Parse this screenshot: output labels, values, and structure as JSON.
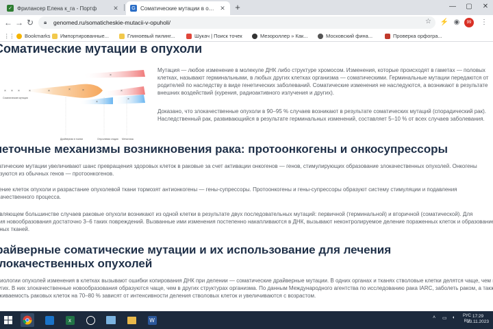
{
  "browser": {
    "tabs": [
      {
        "title": "Фрилансер Елена к_га - Портф",
        "active": false,
        "favicon_color": "#2e7d32"
      },
      {
        "title": "Соматические мутации в опухо",
        "active": true,
        "favicon_color": "#2a6dc6"
      }
    ],
    "new_tab_label": "+",
    "url": "genomed.ru/somaticheskie-mutacii-v-opuholi/",
    "bookmarks": [
      {
        "label": "Bookmarks",
        "color": "#f5b400"
      },
      {
        "label": "Импортированные...",
        "color": "#f2c94c"
      },
      {
        "label": "Глиноевый пилинг...",
        "color": "#f2c94c"
      },
      {
        "label": "Шукач | Поиск точек",
        "color": "#e0463a"
      },
      {
        "label": "Мезороллер » Как...",
        "color": "#333333"
      },
      {
        "label": "Московский фина...",
        "color": "#555555"
      },
      {
        "label": "Проверка орфогра...",
        "color": "#c0392b"
      }
    ],
    "badge_count": "99"
  },
  "article": {
    "title": "Соматические мутации в опухоли",
    "figure_labels": {
      "origin": "Соматические мутации",
      "lbl1": "Драйверная в тканях",
      "lbl2": "Опухолевая стадия",
      "lbl3": "Метастазы"
    },
    "intro_p1": "Мутация — любое изменение в молекуле ДНК либо структуре хромосом. Изменения, которые происходят в гаметах — половых клетках, называют герминальными, в любых других клетках организма — соматическими. Герминальные мутации передаются от родителей по наследству в виде генетических заболеваний. Соматические изменения не наследуются, а возникают в результате внешних воздействий (курения, радиоактивного излучения и других).",
    "intro_p2": "Доказано, что злокачественные опухоли в 90–95 % случаев возникают в результате соматических мутаций (спорадический рак). Наследственный рак, развивающийся в результате герминальных изменений, составляет 5–10 % от всех случаев заболевания.",
    "section2_title": "Клеточные механизмы возникновения рака: протоонкогены и онкосупрессоры",
    "section2_p1": "Соматические мутации увеличивают шанс превращения здоровых клеток в раковые за счет активации онкогенов — генов, стимулирующих образование злокачественных опухолей. Онкогены образуются из обычных генов — протоонкогенов.",
    "section2_p2": "Деление клеток опухоли и разрастание опухолевой ткани тормозят антионкогены — гены-супрессоры. Протоонкогены и гены-супрессоры образуют систему стимуляции и подавления злокачественного процесса.",
    "section2_p3": "В подавляющем большинстве случаев раковые опухоли возникают из одной клетки в результате двух последовательных мутаций: первичной (терминальной) и вторичной (соматической). Для развития новообразования достаточно 3–6 таких повреждений. Вызванные ими изменения постепенно накапливаются в ДНК, вызывают неконтролируемое деление пораженных клеток и образование атипичных тканей.",
    "section3_title_l1": "Драйверные соматические мутации и их использование для лечения",
    "section3_title_l2": "злокачественных опухолей",
    "section3_p1": "В биологии опухолей изменения в клетках вызывают ошибки копирования ДНК при делении — соматические драйверные мутации. В одних органах и тканях стволовые клетки делятся чаще, чем в других. В них злокачественные новообразования образуются чаще, чем в других структурах организма. По данным Международного агентства по исследованию рака IARC, заболеть раком, а также выживаемость раковых клеток на 70–80 % зависят от интенсивности деления стволовых клеток и увеличиваются с возрастом."
  },
  "taskbar": {
    "language": "РУС",
    "language_sub": "RU",
    "time": "17:29",
    "date": "23.11.2023"
  }
}
